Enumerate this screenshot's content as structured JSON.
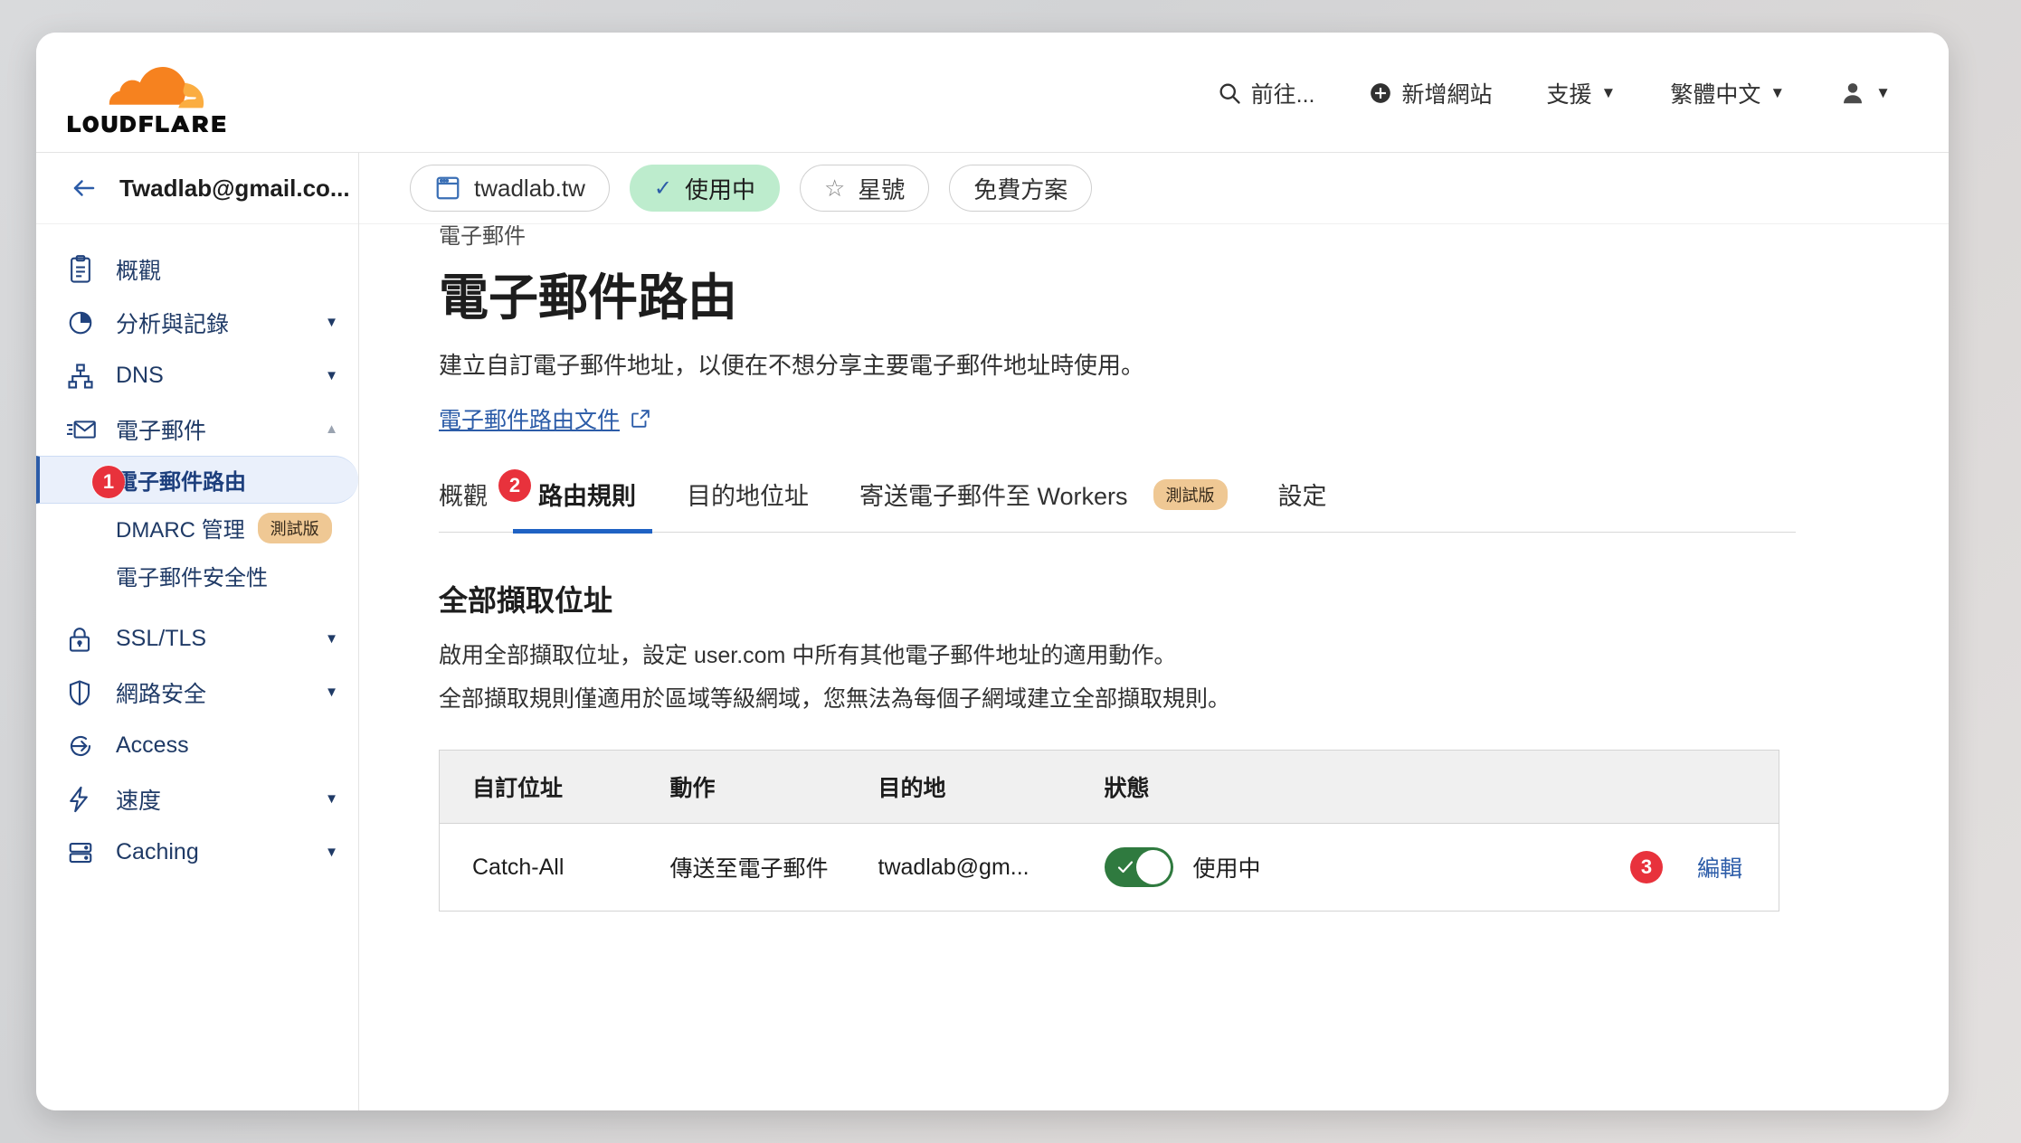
{
  "brand": {
    "name": "CLOUDFLARE",
    "logo_icon": "cloudflare-cloud-logo",
    "accent": "#f6821f"
  },
  "header": {
    "search": {
      "label": "前往...",
      "icon": "search-icon"
    },
    "add_site": {
      "label": "新增網站",
      "icon": "plus-circle-icon"
    },
    "support": {
      "label": "支援",
      "icon": "chevron-down-icon"
    },
    "language": {
      "label": "繁體中文",
      "icon": "chevron-down-icon"
    },
    "account": {
      "icon": "user-avatar-icon",
      "caret": "chevron-down-icon"
    }
  },
  "account_bar": {
    "back_icon": "arrow-left-icon",
    "name": "Twadlab@gmail.co..."
  },
  "domain_bar": {
    "site_icon": "browser-window-icon",
    "site": "twadlab.tw",
    "status": {
      "label": "使用中",
      "icon": "check-icon",
      "color": "#bdeccd"
    },
    "star": {
      "label": "星號",
      "icon": "star-icon"
    },
    "plan": {
      "label": "免費方案"
    }
  },
  "sidebar": {
    "items": [
      {
        "label": "概觀",
        "icon": "clipboard-icon",
        "expandable": false
      },
      {
        "label": "分析與記錄",
        "icon": "pie-chart-icon",
        "expandable": true
      },
      {
        "label": "DNS",
        "icon": "sitemap-icon",
        "expandable": true
      },
      {
        "label": "電子郵件",
        "icon": "email-icon",
        "expandable": true,
        "expanded": true
      },
      {
        "label": "SSL/TLS",
        "icon": "lock-icon",
        "expandable": true
      },
      {
        "label": "網路安全",
        "icon": "shield-icon",
        "expandable": true
      },
      {
        "label": "Access",
        "icon": "access-arrow-icon",
        "expandable": false
      },
      {
        "label": "速度",
        "icon": "lightning-bolt-icon",
        "expandable": true
      },
      {
        "label": "Caching",
        "icon": "database-icon",
        "expandable": true
      }
    ],
    "email_children": [
      {
        "label": "電子郵件路由",
        "active": true,
        "step_badge": "1"
      },
      {
        "label": "DMARC 管理",
        "badge": "測試版"
      },
      {
        "label": "電子郵件安全性"
      }
    ]
  },
  "main": {
    "eyebrow": "電子郵件",
    "title": "電子郵件路由",
    "description": "建立自訂電子郵件地址，以便在不想分享主要電子郵件地址時使用。",
    "doc_link": {
      "label": "電子郵件路由文件",
      "icon": "external-link-icon"
    },
    "tabs": [
      {
        "label": "概觀",
        "active": false
      },
      {
        "label": "路由規則",
        "active": true,
        "step_badge": "2"
      },
      {
        "label": "目的地位址",
        "active": false
      },
      {
        "label": "寄送電子郵件至 Workers",
        "active": false,
        "badge": "測試版"
      },
      {
        "label": "設定",
        "active": false
      }
    ],
    "catch_all": {
      "title": "全部擷取位址",
      "line1": "啟用全部擷取位址，設定 user.com 中所有其他電子郵件地址的適用動作。",
      "line2": "全部擷取規則僅適用於區域等級網域，您無法為每個子網域建立全部擷取規則。"
    },
    "table": {
      "headers": [
        "自訂位址",
        "動作",
        "目的地",
        "狀態",
        ""
      ],
      "row": {
        "custom_address": "Catch-All",
        "action": "傳送至電子郵件",
        "destination": "twadlab@gm...",
        "status_toggle_on": true,
        "status_label": "使用中",
        "edit_label": "編輯",
        "step_badge": "3"
      }
    }
  },
  "colors": {
    "badge_red": "#e8323c",
    "toggle_green": "#2f7a3f",
    "link_blue": "#2c5ca8",
    "tab_underline": "#1f62c4",
    "beta_badge": "#efc894",
    "active_chip": "#bdeccd"
  }
}
